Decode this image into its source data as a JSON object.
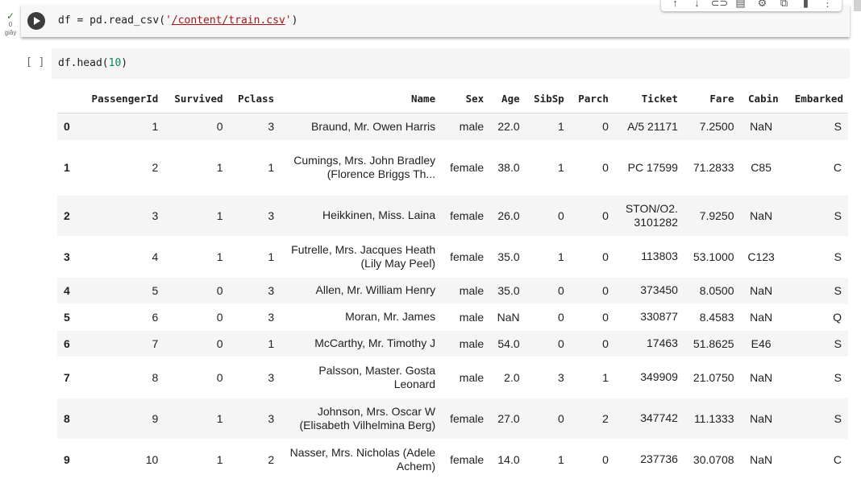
{
  "cell1": {
    "status_time": "0",
    "status_unit": "giây",
    "code_prefix": "df = pd.read_csv(",
    "quote_open": "'",
    "path": "/content/train.csv",
    "quote_close": "'",
    "code_suffix": ")"
  },
  "toolbar": {
    "icons": [
      "arrow-up-icon",
      "arrow-down-icon",
      "link-icon",
      "comment-icon",
      "gear-icon",
      "mirror-cell-icon",
      "delete-icon",
      "more-options-icon"
    ]
  },
  "cell2": {
    "prompt": "[ ]",
    "code_prefix": "df.head(",
    "arg": "10",
    "code_suffix": ")"
  },
  "table": {
    "columns": [
      "",
      "PassengerId",
      "Survived",
      "Pclass",
      "Name",
      "Sex",
      "Age",
      "SibSp",
      "Parch",
      "Ticket",
      "Fare",
      "Cabin",
      "Embarked"
    ],
    "rows": [
      {
        "idx": "0",
        "pid": "1",
        "survived": "0",
        "pclass": "3",
        "name": "Braund, Mr. Owen Harris",
        "sex": "male",
        "age": "22.0",
        "sibsp": "1",
        "parch": "0",
        "ticket": "A/5 21171",
        "fare": "7.2500",
        "cabin": "NaN",
        "embarked": "S"
      },
      {
        "idx": "1",
        "pid": "2",
        "survived": "1",
        "pclass": "1",
        "name": "Cumings, Mrs. John Bradley (Florence Briggs Th...",
        "sex": "female",
        "age": "38.0",
        "sibsp": "1",
        "parch": "0",
        "ticket": "PC 17599",
        "fare": "71.2833",
        "cabin": "C85",
        "embarked": "C"
      },
      {
        "idx": "2",
        "pid": "3",
        "survived": "1",
        "pclass": "3",
        "name": "Heikkinen, Miss. Laina",
        "sex": "female",
        "age": "26.0",
        "sibsp": "0",
        "parch": "0",
        "ticket": "STON/O2. 3101282",
        "fare": "7.9250",
        "cabin": "NaN",
        "embarked": "S"
      },
      {
        "idx": "3",
        "pid": "4",
        "survived": "1",
        "pclass": "1",
        "name": "Futrelle, Mrs. Jacques Heath (Lily May Peel)",
        "sex": "female",
        "age": "35.0",
        "sibsp": "1",
        "parch": "0",
        "ticket": "113803",
        "fare": "53.1000",
        "cabin": "C123",
        "embarked": "S"
      },
      {
        "idx": "4",
        "pid": "5",
        "survived": "0",
        "pclass": "3",
        "name": "Allen, Mr. William Henry",
        "sex": "male",
        "age": "35.0",
        "sibsp": "0",
        "parch": "0",
        "ticket": "373450",
        "fare": "8.0500",
        "cabin": "NaN",
        "embarked": "S"
      },
      {
        "idx": "5",
        "pid": "6",
        "survived": "0",
        "pclass": "3",
        "name": "Moran, Mr. James",
        "sex": "male",
        "age": "NaN",
        "sibsp": "0",
        "parch": "0",
        "ticket": "330877",
        "fare": "8.4583",
        "cabin": "NaN",
        "embarked": "Q"
      },
      {
        "idx": "6",
        "pid": "7",
        "survived": "0",
        "pclass": "1",
        "name": "McCarthy, Mr. Timothy J",
        "sex": "male",
        "age": "54.0",
        "sibsp": "0",
        "parch": "0",
        "ticket": "17463",
        "fare": "51.8625",
        "cabin": "E46",
        "embarked": "S"
      },
      {
        "idx": "7",
        "pid": "8",
        "survived": "0",
        "pclass": "3",
        "name": "Palsson, Master. Gosta Leonard",
        "sex": "male",
        "age": "2.0",
        "sibsp": "3",
        "parch": "1",
        "ticket": "349909",
        "fare": "21.0750",
        "cabin": "NaN",
        "embarked": "S"
      },
      {
        "idx": "8",
        "pid": "9",
        "survived": "1",
        "pclass": "3",
        "name": "Johnson, Mrs. Oscar W (Elisabeth Vilhelmina Berg)",
        "sex": "female",
        "age": "27.0",
        "sibsp": "0",
        "parch": "2",
        "ticket": "347742",
        "fare": "11.1333",
        "cabin": "NaN",
        "embarked": "S"
      },
      {
        "idx": "9",
        "pid": "10",
        "survived": "1",
        "pclass": "2",
        "name": "Nasser, Mrs. Nicholas (Adele Achem)",
        "sex": "female",
        "age": "14.0",
        "sibsp": "1",
        "parch": "0",
        "ticket": "237736",
        "fare": "30.0708",
        "cabin": "NaN",
        "embarked": "C"
      }
    ]
  }
}
